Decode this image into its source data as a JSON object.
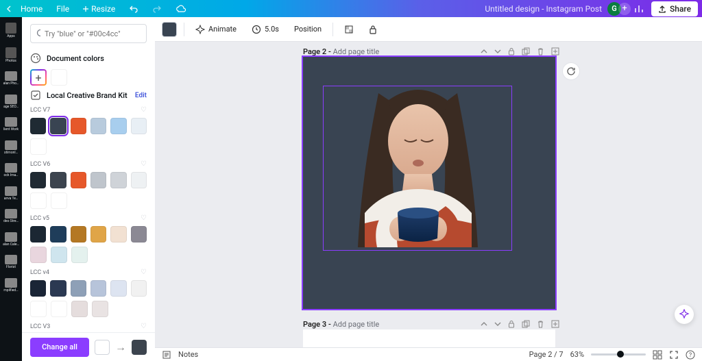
{
  "topbar": {
    "home": "Home",
    "file": "File",
    "resize": "Resize",
    "title": "Untitled design - Instagram Post",
    "share": "Share",
    "avatar_initial": "G"
  },
  "rail": {
    "items": [
      {
        "label": "Apps"
      },
      {
        "label": "Photos"
      },
      {
        "label": "alan Pho…"
      },
      {
        "label": "age SEO…"
      },
      {
        "label": "lient Work"
      },
      {
        "label": "stimonl…"
      },
      {
        "label": "ock Ima…"
      },
      {
        "label": "anva Te…"
      },
      {
        "label": "deo Stre…"
      },
      {
        "label": "alan Cale…"
      },
      {
        "label": "Florist"
      },
      {
        "label": "mplified…"
      }
    ]
  },
  "panel": {
    "search_placeholder": "Try \"blue\" or \"#00c4cc\"",
    "document_colors": "Document colors",
    "brand_kit_title": "Local Creative Brand Kit",
    "edit": "Edit",
    "change_all": "Change all",
    "groups": [
      {
        "name": "LCC V7",
        "rows": [
          [
            "#1f2a33",
            "#394452",
            "#e6582a",
            "#b8cbdd",
            "#a8ceee",
            "#e8eff5"
          ],
          [
            "#ffffff"
          ]
        ],
        "selected": [
          0,
          1
        ]
      },
      {
        "name": "LCC V6",
        "rows": [
          [
            "#202a33",
            "#3c444e",
            "#e6582a",
            "#bfc5cc",
            "#cfd3d8",
            "#eef1f3"
          ],
          [
            "#ffffff",
            "#ffffff"
          ]
        ]
      },
      {
        "name": "LCC v5",
        "rows": [
          [
            "#1b2733",
            "#1f3d5a",
            "#b47824",
            "#e0a548",
            "#f2e1d2",
            "#8b8994"
          ],
          [
            "#e9d6de",
            "#cfe5ee",
            "#e4f1ee"
          ]
        ]
      },
      {
        "name": "LCC v4",
        "rows": [
          [
            "#1a2536",
            "#2b3952",
            "#8ea0b7",
            "#b7c4da",
            "#dde4f1",
            "#f1f1f1"
          ],
          [
            "#ffffff",
            "#ffffff",
            "#e5dddd",
            "#e9e3e3"
          ]
        ]
      },
      {
        "name": "LCC V3",
        "rows": [
          [
            "#1b2636",
            "#2d4664",
            "#8a97a8",
            "#c7c3d6",
            "#e2e4e7",
            "#f2f2f2"
          ]
        ]
      }
    ],
    "footer_swatches": [
      "#ffffff",
      "#3c444e"
    ]
  },
  "context": {
    "animate": "Animate",
    "duration": "5.0s",
    "position": "Position"
  },
  "pages": {
    "p2_label_bold": "Page 2 - ",
    "p2_label_rest": "Add page title",
    "p3_label_bold": "Page 3 - ",
    "p3_label_rest": "Add page title"
  },
  "bottom": {
    "notes": "Notes",
    "page_indicator": "Page 2 / 7",
    "zoom": "63%"
  }
}
